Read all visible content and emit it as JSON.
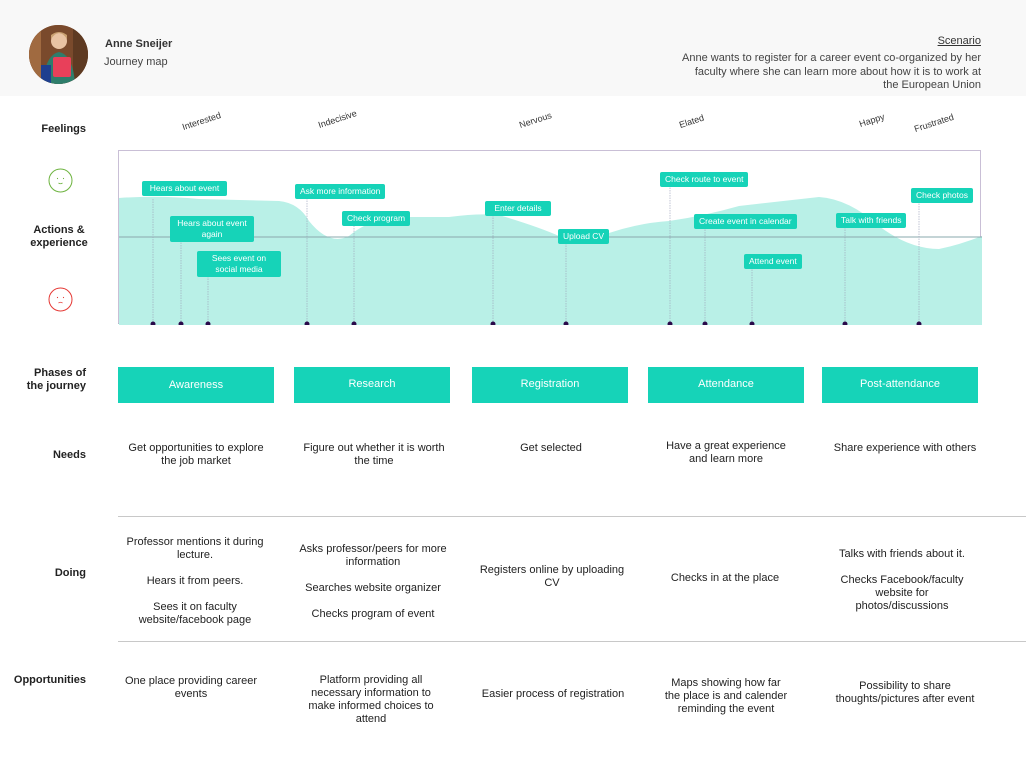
{
  "persona": {
    "name": "Anne Sneijer",
    "subtitle": "Journey map"
  },
  "scenario": {
    "title": "Scenario",
    "text": "Anne wants to register for a career event co-organized by her faculty where she can learn more about how it is to work at the European Union"
  },
  "row_labels": {
    "feelings": "Feelings",
    "actions": "Actions & experience",
    "phases": "Phases of the journey",
    "needs": "Needs",
    "doing": "Doing",
    "opportunities": "Opportunities"
  },
  "feelings": [
    "Interested",
    "Indecisive",
    "Nervous",
    "Elated",
    "Happy",
    "Frustrated"
  ],
  "faces": {
    "positive": "happy-face-icon",
    "negative": "sad-face-icon",
    "positive_color": "#6db33f",
    "negative_color": "#e53935"
  },
  "colors": {
    "accent": "#16d3b8",
    "curve_fill": "#b9f0e7",
    "dot": "#2a0a4a"
  },
  "actions": [
    "Hears about event",
    "Hears about event again",
    "Sees event on social media",
    "Ask more information",
    "Check program",
    "Enter details",
    "Upload CV",
    "Check route to event",
    "Create event in calendar",
    "Attend event",
    "Talk with friends",
    "Check photos"
  ],
  "phases": [
    "Awareness",
    "Research",
    "Registration",
    "Attendance",
    "Post-attendance"
  ],
  "needs": [
    "Get opportunities to explore the job market",
    "Figure out whether it is worth the time",
    "Get selected",
    "Have a great experience and learn more",
    "Share experience with others"
  ],
  "doing": [
    [
      "Professor mentions it during lecture.",
      "Hears it from peers.",
      "Sees it on faculty website/facebook page"
    ],
    [
      "Asks professor/peers for more information",
      "Searches website organizer",
      "Checks program of event"
    ],
    [
      "Registers online by uploading CV"
    ],
    [
      "Checks in at the place"
    ],
    [
      "Talks with friends about it.",
      "Checks Facebook/faculty website for photos/discussions"
    ]
  ],
  "opportunities": [
    "One place providing career events",
    "Platform providing all necessary information to make informed choices to attend",
    "Easier process of registration",
    "Maps showing how far the place is and calender reminding the event",
    "Possibility to share thoughts/pictures after event"
  ]
}
